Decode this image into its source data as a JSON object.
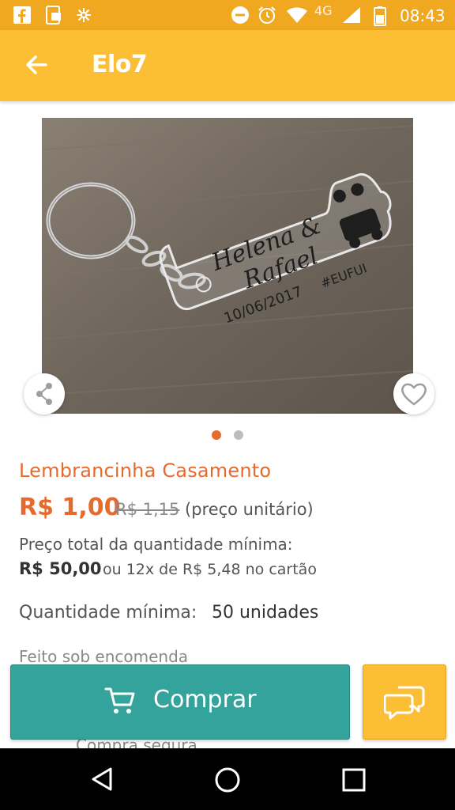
{
  "status_bar": {
    "time": "08:43",
    "network": "4G",
    "icons": [
      "facebook-icon",
      "screenshot-icon",
      "gear-icon",
      "minus-circle-icon",
      "alarm-icon",
      "wifi-icon",
      "signal-icon",
      "battery-icon"
    ]
  },
  "app_bar": {
    "title": "Elo7",
    "back_icon": "arrow-back-icon"
  },
  "product": {
    "image": {
      "engraving_names_1": "Helena &",
      "engraving_names_2": "Rafael",
      "engraving_date": "10/06/2017",
      "engraving_tag": "#EUFUI"
    },
    "carousel": {
      "count": 2,
      "active": 0
    },
    "title": "Lembrancinha Casamento",
    "price": "R$ 1,00",
    "old_price": "R$ 1,15",
    "unit_note": "(preço unitário)",
    "total_label": "Preço total da quantidade mínima:",
    "total_price": "R$ 50,00",
    "installments": "ou 12x de R$ 5,48 no cartão",
    "min_qty_label": "Quantidade mínima:",
    "min_qty_value": "50 unidades",
    "faded_text_1": "Feito sob encomenda",
    "faded_text_2": "Compra segura"
  },
  "actions": {
    "buy_label": "Comprar",
    "buy_icon": "cart-icon",
    "chat_icon": "chat-icon"
  },
  "colors": {
    "brand_yellow": "#fbbe34",
    "status_yellow": "#f0a821",
    "accent_orange": "#e56a2b",
    "teal": "#33a39b"
  },
  "nav_bar": {
    "icons": [
      "back-triangle-icon",
      "home-circle-icon",
      "recents-square-icon"
    ]
  }
}
